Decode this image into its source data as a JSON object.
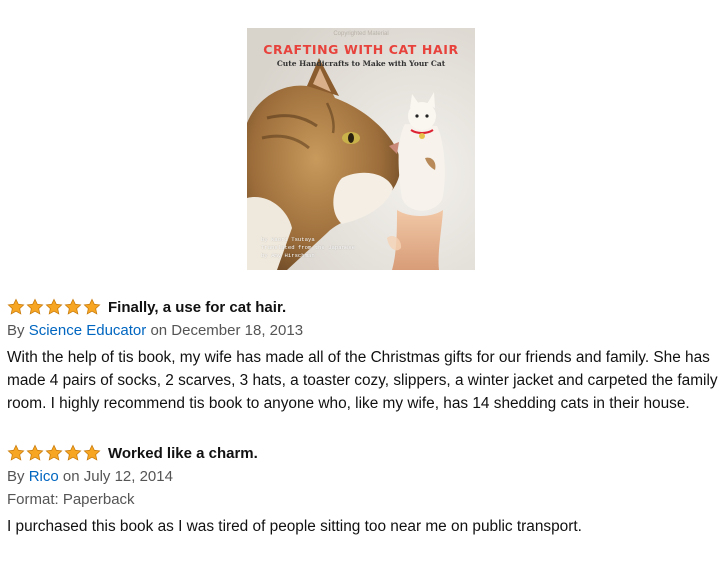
{
  "book": {
    "copyright_mark": "Copyrighted Material",
    "title": "CRAFTING WITH CAT HAIR",
    "subtitle": "Cute Handicrafts to Make with Your Cat",
    "credits": [
      "by Kaori Tsutaya",
      "Translated from the Japanese",
      "by Amy Hirschman"
    ]
  },
  "reviews": [
    {
      "rating": 5,
      "title": "Finally, a use for cat hair.",
      "by_prefix": "By",
      "author": "Science Educator",
      "date_text": "on December 18, 2013",
      "format": "",
      "body": "With the help of tis book, my wife has made all of the Christmas gifts for our friends and family. She has made 4 pairs of socks, 2 scarves, 3 hats, a toaster cozy, slippers, a winter jacket and carpeted the family room. I highly recommend tis book to anyone who, like my wife, has 14 shedding cats in their house."
    },
    {
      "rating": 5,
      "title": "Worked like a charm.",
      "by_prefix": "By",
      "author": "Rico",
      "date_text": "on July 12, 2014",
      "format": "Format: Paperback",
      "body": "I purchased this book as I was tired of people sitting too near me on public transport."
    }
  ],
  "colors": {
    "star": "#f6a623",
    "star_outline": "#c77a0a",
    "author_link": "#0066c0",
    "cover_title": "#e8423c"
  }
}
